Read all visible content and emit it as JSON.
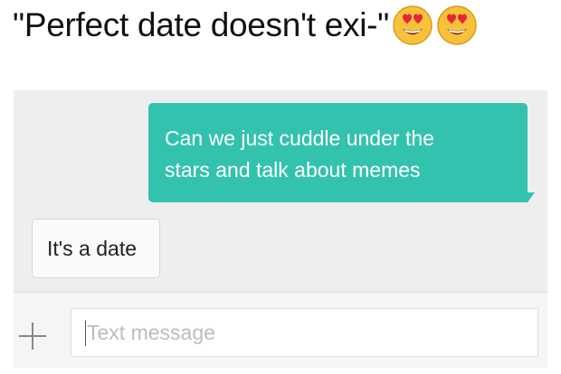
{
  "caption": {
    "text": "\"Perfect date doesn't exi-\"",
    "emojis": [
      "heart-eyes-emoji",
      "heart-eyes-emoji"
    ]
  },
  "conversation": {
    "sent_message": {
      "line1": "Can we just cuddle under the",
      "line2": "stars and talk about memes",
      "color": "#33c2ae"
    },
    "received_message": {
      "text": "It's a date"
    }
  },
  "composer": {
    "attach_icon": "plus-icon",
    "placeholder": "Text message",
    "value": ""
  }
}
